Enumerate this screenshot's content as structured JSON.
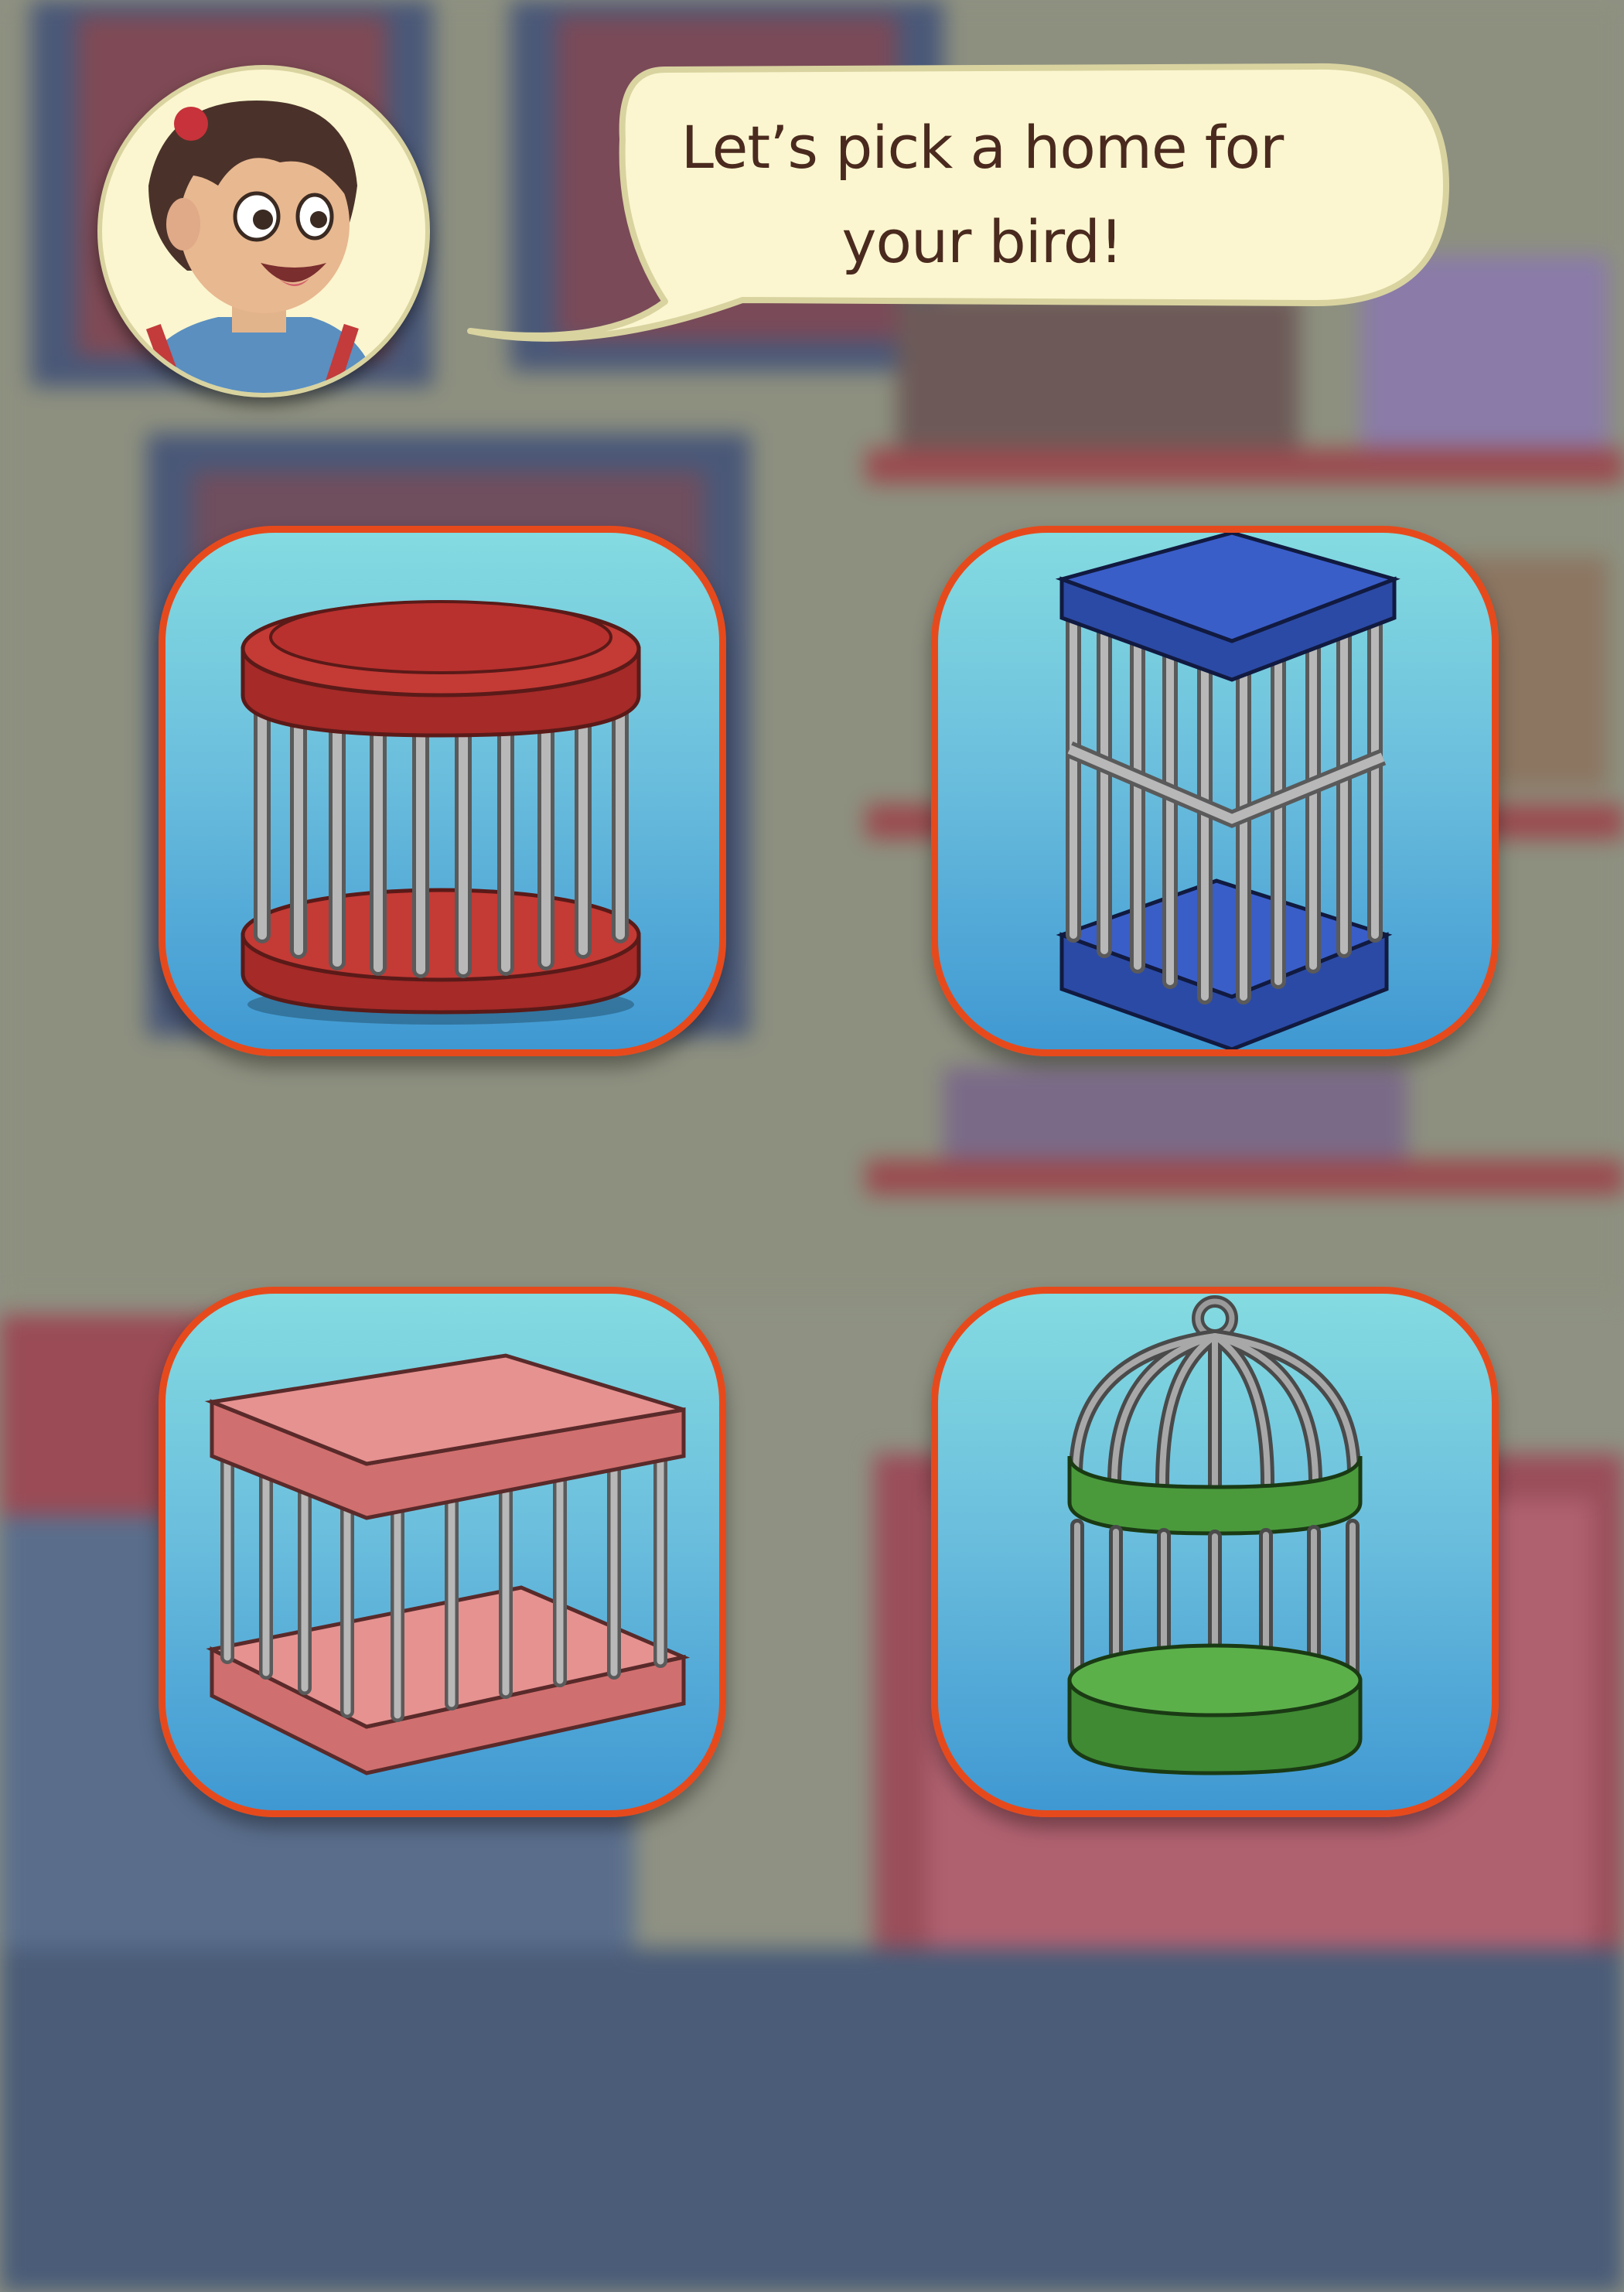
{
  "dialog": {
    "speaker_icon": "girl-avatar",
    "line1": "Let’s pick a home for",
    "line2": "your bird!"
  },
  "options": [
    {
      "id": "red-round-cage",
      "color": "#b3312f",
      "icon": "round-cage-icon"
    },
    {
      "id": "blue-tall-cage",
      "color": "#2e4fae",
      "icon": "tall-cage-icon"
    },
    {
      "id": "pink-square-cage",
      "color": "#d97b7b",
      "icon": "square-cage-icon"
    },
    {
      "id": "green-dome-cage",
      "color": "#4a9a3c",
      "icon": "dome-cage-icon"
    }
  ],
  "colors": {
    "card_border": "#e64a1c",
    "card_top": "#84dbe0",
    "card_bottom": "#3f98d2",
    "bubble_fill": "#fbf6cf",
    "text": "#4a2a1e"
  }
}
